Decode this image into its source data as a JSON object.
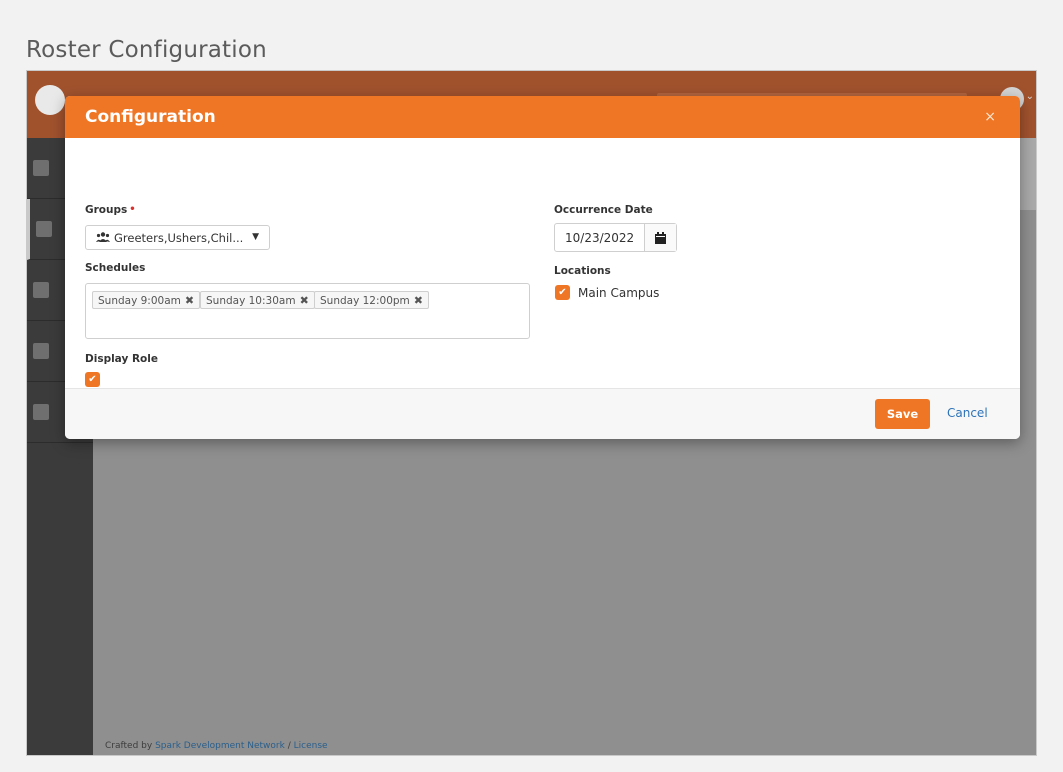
{
  "page": {
    "heading": "Roster Configuration"
  },
  "modal": {
    "title": "Configuration",
    "close_glyph": "×",
    "groups": {
      "label": "Groups",
      "required_mark": "•",
      "value": "Greeters,Ushers,Chil...",
      "icon": "users-icon"
    },
    "schedules": {
      "label": "Schedules",
      "tags": [
        {
          "label": "Sunday 9:00am"
        },
        {
          "label": "Sunday 10:30am"
        },
        {
          "label": "Sunday 12:00pm"
        }
      ],
      "remove_glyph": "✖"
    },
    "display_role": {
      "label": "Display Role",
      "checked": true
    },
    "occurrence_date": {
      "label": "Occurrence Date",
      "value": "10/23/2022",
      "icon": "calendar-icon"
    },
    "locations": {
      "label": "Locations",
      "options": [
        {
          "label": "Main Campus",
          "checked": true
        }
      ]
    },
    "footer": {
      "save_label": "Save",
      "cancel_label": "Cancel"
    }
  },
  "footer": {
    "prefix": "Crafted by",
    "link1": "Spark Development Network",
    "separator": "/",
    "link2": "License"
  },
  "colors": {
    "accent": "#ee7625",
    "link": "#2d73b8",
    "required": "#d9302c"
  }
}
